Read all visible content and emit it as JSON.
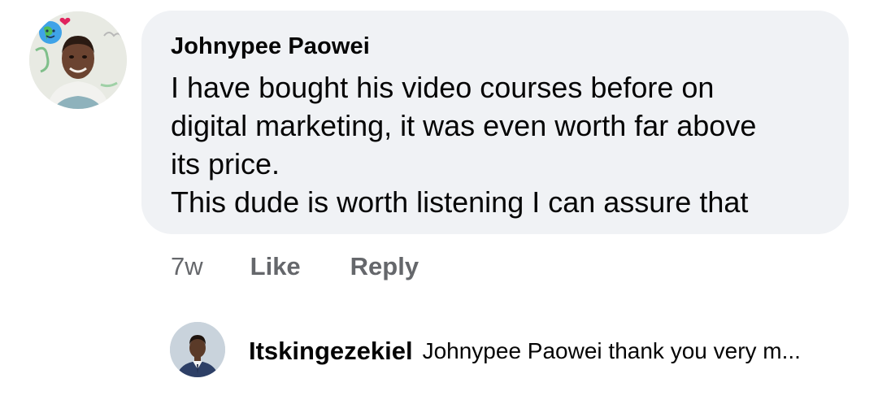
{
  "comment": {
    "author": "Johnypee Paowei",
    "lines": [
      "I have bought his video courses before on",
      "digital marketing, it was even worth far above",
      "its price.",
      "This dude is worth listening I can assure that"
    ],
    "time": "7w",
    "like_label": "Like",
    "reply_label": "Reply"
  },
  "reply": {
    "author": "Itskingezekiel",
    "text": "Johnypee Paowei thank you very m..."
  },
  "colors": {
    "bubble": "#f0f2f5",
    "text": "#050505",
    "meta": "#65676b"
  }
}
